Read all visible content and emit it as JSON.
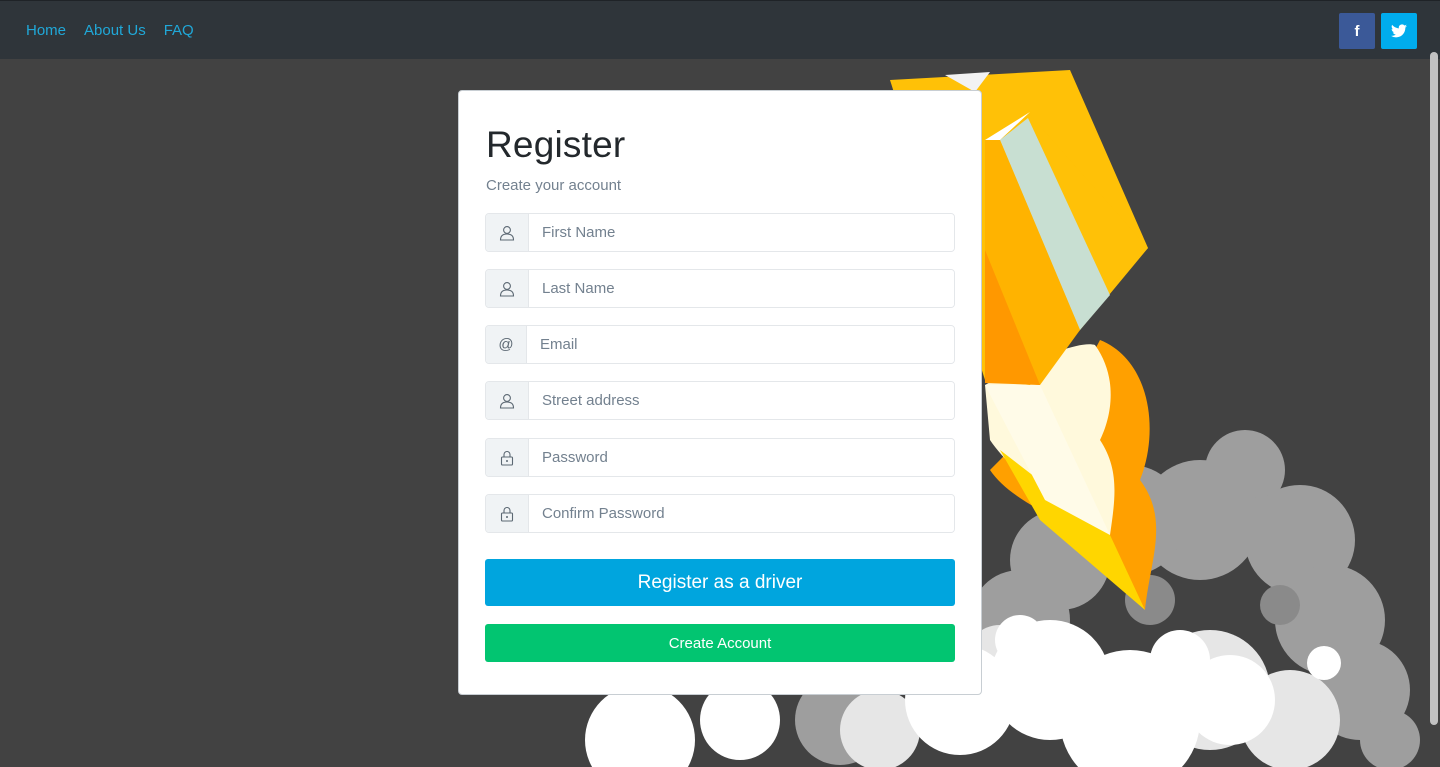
{
  "nav": {
    "links": [
      "Home",
      "About Us",
      "FAQ"
    ],
    "social": [
      {
        "name": "facebook",
        "glyph": "f",
        "color": "#3b5998"
      },
      {
        "name": "twitter",
        "glyph": "t",
        "color": "#00aced"
      }
    ]
  },
  "form": {
    "title": "Register",
    "subtitle": "Create your account",
    "fields": [
      {
        "icon": "user-icon",
        "placeholder": "First Name",
        "value": ""
      },
      {
        "icon": "user-icon",
        "placeholder": "Last Name",
        "value": ""
      },
      {
        "icon": "at-icon",
        "placeholder": "Email",
        "value": ""
      },
      {
        "icon": "user-icon",
        "placeholder": "Street address",
        "value": ""
      },
      {
        "icon": "lock-icon",
        "placeholder": "Password",
        "value": ""
      },
      {
        "icon": "lock-icon",
        "placeholder": "Confirm Password",
        "value": ""
      }
    ],
    "at_symbol": "@",
    "driver_button": "Register as a driver",
    "create_button": "Create Account"
  },
  "colors": {
    "link": "#20a8d8",
    "driver_button": "#00a5de",
    "create_button": "#02c571",
    "background": "#424242",
    "navbar": "#2f353a"
  }
}
